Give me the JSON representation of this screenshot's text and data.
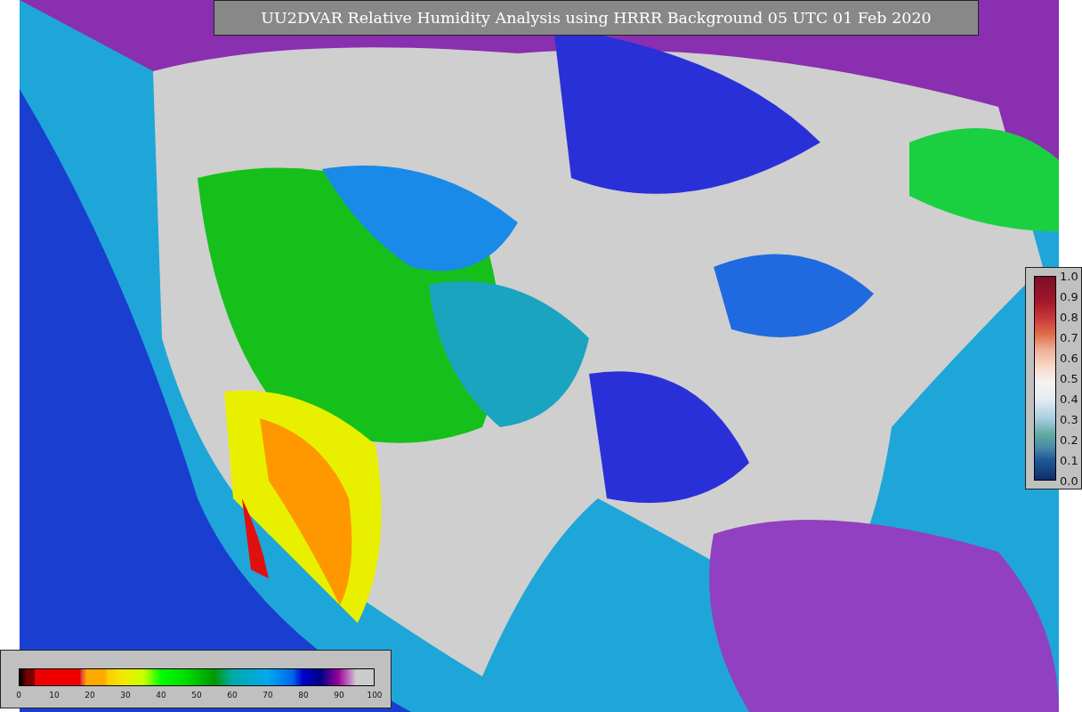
{
  "title": "UU2DVAR Relative Humidity Analysis using HRRR Background 05 UTC 01 Feb 2020",
  "humidity_colorbar": {
    "ticks": [
      "0",
      "10",
      "20",
      "30",
      "40",
      "50",
      "60",
      "70",
      "80",
      "90",
      "100"
    ]
  },
  "ratio_colorbar": {
    "ticks": [
      "1.0",
      "0.9",
      "0.8",
      "0.7",
      "0.6",
      "0.5",
      "0.4",
      "0.3",
      "0.2",
      "0.1",
      "0.0"
    ]
  }
}
